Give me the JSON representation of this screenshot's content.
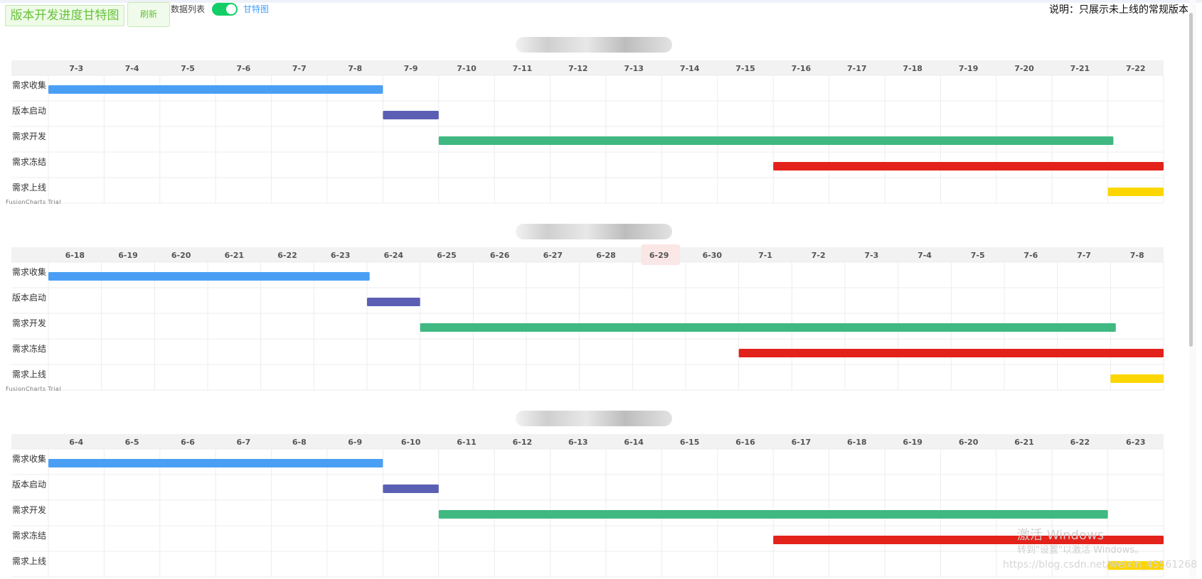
{
  "header": {
    "title": "版本开发进度甘特图",
    "refresh_label": "刷新",
    "list_label": "数据列表",
    "gantt_label": "甘特图",
    "toggle_on": true,
    "note": "说明：只展示未上线的常规版本"
  },
  "trial_text": "FusionCharts Trial",
  "watermark": {
    "line1": "激活 Windows",
    "line2": "转到\"设置\"以激活 Windows。",
    "url": "https://blog.csdn.net/weixin_45561268"
  },
  "colors": {
    "need_collect": "#4a9ff5",
    "version_start": "#5b5fb4",
    "need_dev": "#3fb882",
    "need_freeze": "#e3221b",
    "need_online": "#fcd600",
    "header_bg": "#f2f2f2",
    "highlight": "#fbe6e6"
  },
  "chart_data": [
    {
      "type": "gantt",
      "title": "",
      "categories": [
        "7-3",
        "7-4",
        "7-5",
        "7-6",
        "7-7",
        "7-8",
        "7-9",
        "7-10",
        "7-11",
        "7-12",
        "7-13",
        "7-14",
        "7-15",
        "7-16",
        "7-17",
        "7-18",
        "7-19",
        "7-20",
        "7-21",
        "7-22"
      ],
      "highlight_index": null,
      "tasks": [
        {
          "label": "需求收集",
          "start": 0,
          "end": 6,
          "color_key": "need_collect"
        },
        {
          "label": "版本启动",
          "start": 6,
          "end": 7,
          "color_key": "version_start"
        },
        {
          "label": "需求开发",
          "start": 7,
          "end": 19.1,
          "color_key": "need_dev"
        },
        {
          "label": "需求冻结",
          "start": 13,
          "end": 20,
          "color_key": "need_freeze"
        },
        {
          "label": "需求上线",
          "start": 19,
          "end": 20,
          "color_key": "need_online"
        }
      ]
    },
    {
      "type": "gantt",
      "title": "",
      "categories": [
        "6-18",
        "6-19",
        "6-20",
        "6-21",
        "6-22",
        "6-23",
        "6-24",
        "6-25",
        "6-26",
        "6-27",
        "6-28",
        "6-29",
        "6-30",
        "7-1",
        "7-2",
        "7-3",
        "7-4",
        "7-5",
        "7-6",
        "7-7",
        "7-8"
      ],
      "highlight_index": 11,
      "tasks": [
        {
          "label": "需求收集",
          "start": 0,
          "end": 6.05,
          "color_key": "need_collect"
        },
        {
          "label": "版本启动",
          "start": 6,
          "end": 7,
          "color_key": "version_start"
        },
        {
          "label": "需求开发",
          "start": 7,
          "end": 20.1,
          "color_key": "need_dev"
        },
        {
          "label": "需求冻结",
          "start": 13,
          "end": 21,
          "color_key": "need_freeze"
        },
        {
          "label": "需求上线",
          "start": 20,
          "end": 21,
          "color_key": "need_online"
        }
      ]
    },
    {
      "type": "gantt",
      "title": "",
      "categories": [
        "6-4",
        "6-5",
        "6-6",
        "6-7",
        "6-8",
        "6-9",
        "6-10",
        "6-11",
        "6-12",
        "6-13",
        "6-14",
        "6-15",
        "6-16",
        "6-17",
        "6-18",
        "6-19",
        "6-20",
        "6-21",
        "6-22",
        "6-23"
      ],
      "highlight_index": null,
      "tasks": [
        {
          "label": "需求收集",
          "start": 0,
          "end": 6,
          "color_key": "need_collect"
        },
        {
          "label": "版本启动",
          "start": 6,
          "end": 7,
          "color_key": "version_start"
        },
        {
          "label": "需求开发",
          "start": 7,
          "end": 19,
          "color_key": "need_dev"
        },
        {
          "label": "需求冻结",
          "start": 13,
          "end": 20,
          "color_key": "need_freeze"
        },
        {
          "label": "需求上线",
          "start": 19,
          "end": 20,
          "color_key": "need_online"
        }
      ]
    }
  ]
}
